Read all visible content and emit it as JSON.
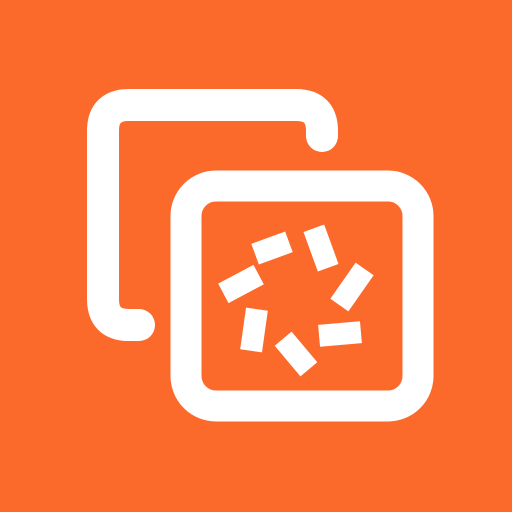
{
  "icon": {
    "name": "copy-spinner-icon",
    "colors": {
      "background": "#FB692B",
      "foreground": "#FFFFFF"
    }
  }
}
